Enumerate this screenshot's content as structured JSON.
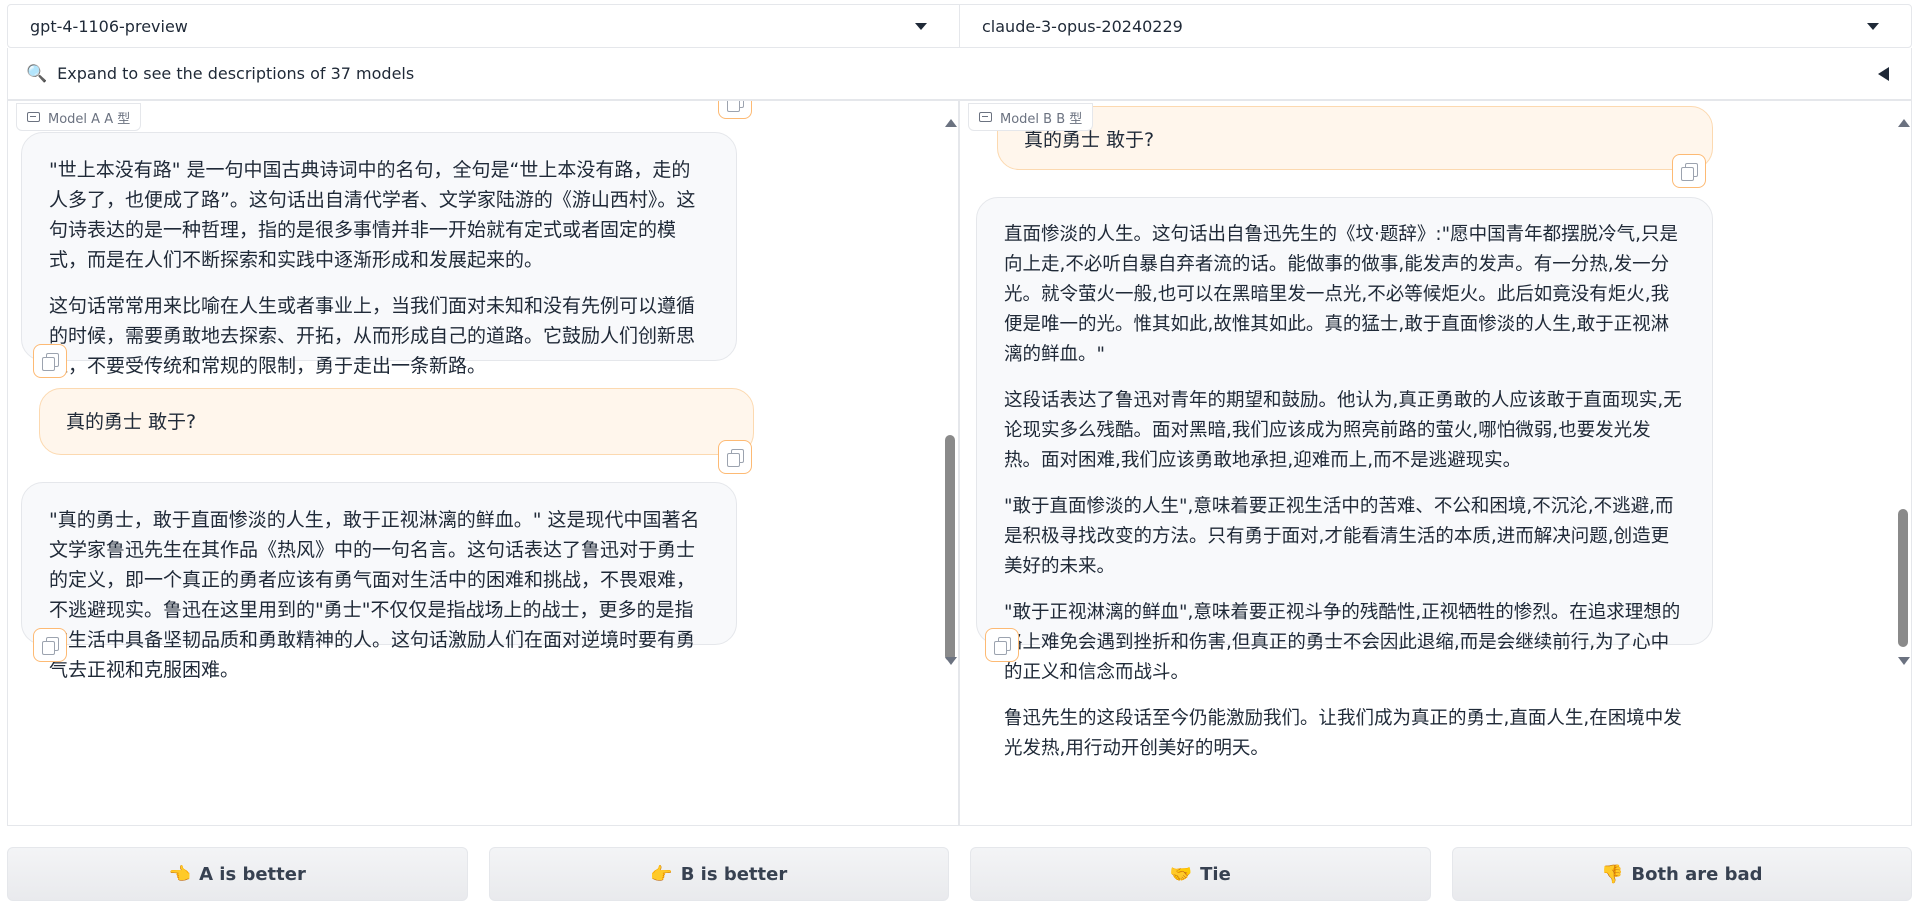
{
  "models": {
    "a_selected": "gpt-4-1106-preview",
    "b_selected": "claude-3-opus-20240229"
  },
  "accordion": {
    "icon": "magnifier-icon",
    "label": "Expand to see the descriptions of 37 models"
  },
  "panel_a": {
    "label": "Model A A 型",
    "messages": [
      {
        "role": "assistant",
        "paragraphs": [
          "\"世上本没有路\" 是一句中国古典诗词中的名句，全句是“世上本没有路，走的人多了，也便成了路”。这句话出自清代学者、文学家陆游的《游山西村》。这句诗表达的是一种哲理，指的是很多事情并非一开始就有定式或者固定的模式，而是在人们不断探索和实践中逐渐形成和发展起来的。",
          "这句话常常用来比喻在人生或者事业上，当我们面对未知和没有先例可以遵循的时候，需要勇敢地去探索、开拓，从而形成自己的道路。它鼓励人们创新思维，不要受传统和常规的限制，勇于走出一条新路。"
        ]
      },
      {
        "role": "user",
        "text": "真的勇士 敢于?"
      },
      {
        "role": "assistant",
        "paragraphs": [
          "\"真的勇士，敢于直面惨淡的人生，敢于正视淋漓的鲜血。\" 这是现代中国著名文学家鲁迅先生在其作品《热风》中的一句名言。这句话表达了鲁迅对于勇士的定义，即一个真正的勇者应该有勇气面对生活中的困难和挑战，不畏艰难，不逃避现实。鲁迅在这里用到的\"勇士\"不仅仅是指战场上的战士，更多的是指在生活中具备坚韧品质和勇敢精神的人。这句话激励人们在面对逆境时要有勇气去正视和克服困难。"
        ]
      }
    ]
  },
  "panel_b": {
    "label": "Model B B 型",
    "messages": [
      {
        "role": "user",
        "text": "真的勇士 敢于?"
      },
      {
        "role": "assistant",
        "paragraphs": [
          "直面惨淡的人生。这句话出自鲁迅先生的《坟·题辞》:\"愿中国青年都摆脱冷气,只是向上走,不必听自暴自弃者流的话。能做事的做事,能发声的发声。有一分热,发一分光。就令萤火一般,也可以在黑暗里发一点光,不必等候炬火。此后如竟没有炬火,我便是唯一的光。惟其如此,故惟其如此。真的猛士,敢于直面惨淡的人生,敢于正视淋漓的鲜血。\"",
          "这段话表达了鲁迅对青年的期望和鼓励。他认为,真正勇敢的人应该敢于直面现实,无论现实多么残酷。面对黑暗,我们应该成为照亮前路的萤火,哪怕微弱,也要发光发热。面对困难,我们应该勇敢地承担,迎难而上,而不是逃避现实。",
          "\"敢于直面惨淡的人生\",意味着要正视生活中的苦难、不公和困境,不沉沦,不逃避,而是积极寻找改变的方法。只有勇于面对,才能看清生活的本质,进而解决问题,创造更美好的未来。",
          "\"敢于正视淋漓的鲜血\",意味着要正视斗争的残酷性,正视牺牲的惨烈。在追求理想的路上难免会遇到挫折和伤害,但真正的勇士不会因此退缩,而是会继续前行,为了心中的正义和信念而战斗。",
          "鲁迅先生的这段话至今仍能激励我们。让我们成为真正的勇士,直面人生,在困境中发光发热,用行动开创美好的明天。"
        ]
      }
    ]
  },
  "votes": [
    {
      "icon": "👈",
      "label": "A is better"
    },
    {
      "icon": "👉",
      "label": "B is better"
    },
    {
      "icon": "🤝",
      "label": "Tie"
    },
    {
      "icon": "👎",
      "label": "Both are bad"
    }
  ],
  "colors": {
    "user_bubble": "#fff6ec",
    "user_border": "#fcd9b0",
    "bot_bubble": "#f8f9fb",
    "copy_border": "#fdba74"
  }
}
